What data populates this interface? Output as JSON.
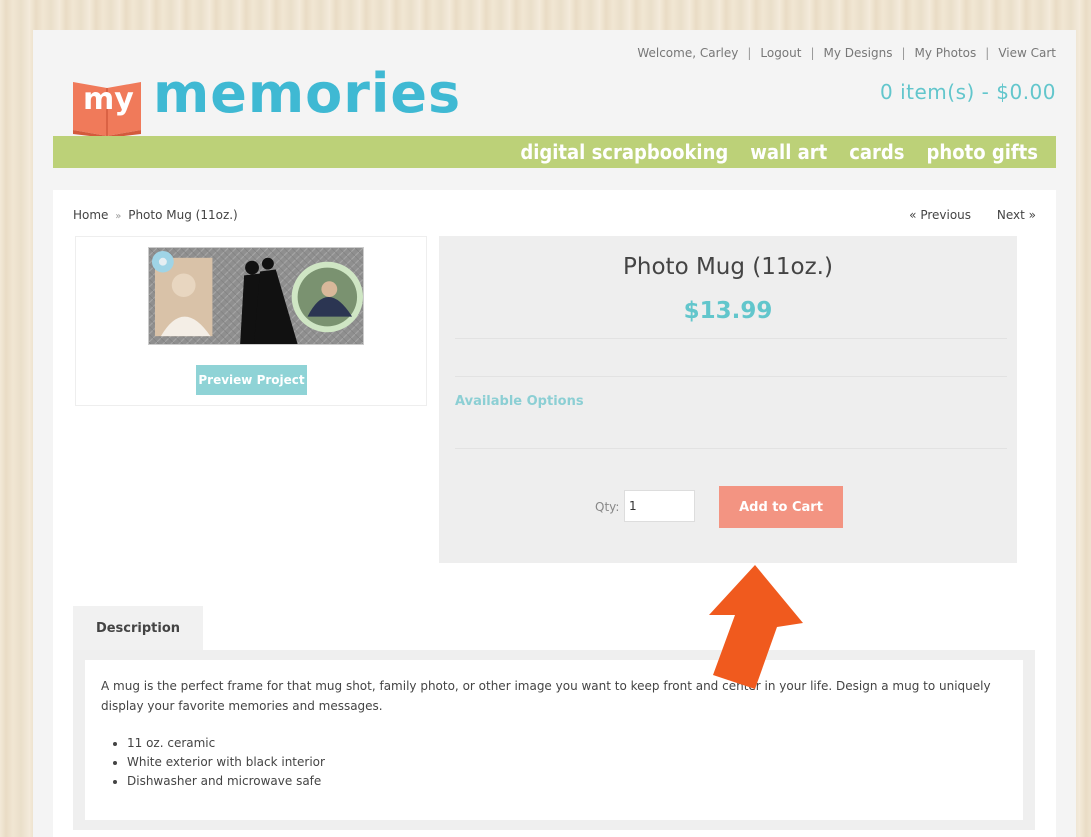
{
  "header": {
    "links": [
      "Welcome, Carley",
      "Logout",
      "My Designs",
      "My Photos",
      "View Cart"
    ],
    "cart_summary": "0 item(s) - $0.00",
    "logo_my": "my",
    "logo_memories": "memories"
  },
  "nav": {
    "items": [
      "digital scrapbooking",
      "wall art",
      "cards",
      "photo gifts"
    ]
  },
  "breadcrumb": {
    "home": "Home",
    "separator": "»",
    "current": "Photo Mug (11oz.)"
  },
  "pager": {
    "previous": "« Previous",
    "next": "Next »"
  },
  "product": {
    "title": "Photo Mug (11oz.)",
    "price": "$13.99",
    "preview_label": "Preview Project",
    "options_label": "Available Options",
    "qty_label": "Qty:",
    "qty_value": "1",
    "add_to_cart_label": "Add to Cart"
  },
  "description": {
    "tab_label": "Description",
    "text": "A mug is the perfect frame for that mug shot, family photo, or other image you want to keep front and center in your life. Design a mug to uniquely display your favorite memories and messages.",
    "features": [
      "11 oz. ceramic",
      "White exterior with black interior",
      "Dishwasher and microwave safe"
    ]
  },
  "colors": {
    "accent_teal": "#62c6cc",
    "nav_green": "#bcd178",
    "cart_button": "#f39482",
    "arrow_orange": "#f05a1e"
  }
}
